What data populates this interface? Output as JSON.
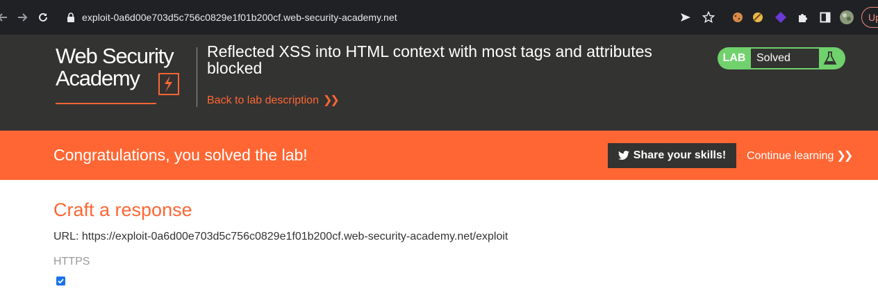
{
  "browser": {
    "url": "exploit-0a6d00e703d5c756c0829e1f01b200cf.web-security-academy.net",
    "update_label": "Up",
    "icons": [
      "back-arrow-icon",
      "forward-arrow-icon",
      "reload-icon",
      "lock-icon",
      "send-icon",
      "star-icon",
      "cookie-extension-icon",
      "cookie-extension-icon-2",
      "purple-extension-icon",
      "puzzle-extensions-icon",
      "sidebar-icon",
      "profile-avatar-icon"
    ]
  },
  "header": {
    "logo_line1": "Web Security",
    "logo_line2": "Academy",
    "lab_title": "Reflected XSS into HTML context with most tags and attributes blocked",
    "back_link": "Back to lab description",
    "lab_badge": "LAB",
    "lab_status": "Solved"
  },
  "banner": {
    "message": "Congratulations, you solved the lab!",
    "share_label": "Share your skills!",
    "continue_label": "Continue learning"
  },
  "content": {
    "title": "Craft a response",
    "url_line": "URL: https://exploit-0a6d00e703d5c756c0829e1f01b200cf.web-security-academy.net/exploit",
    "https_label": "HTTPS",
    "https_checked": true
  },
  "colors": {
    "accent": "#ff6633",
    "dark": "#333332",
    "solved_green": "#70d16d"
  }
}
